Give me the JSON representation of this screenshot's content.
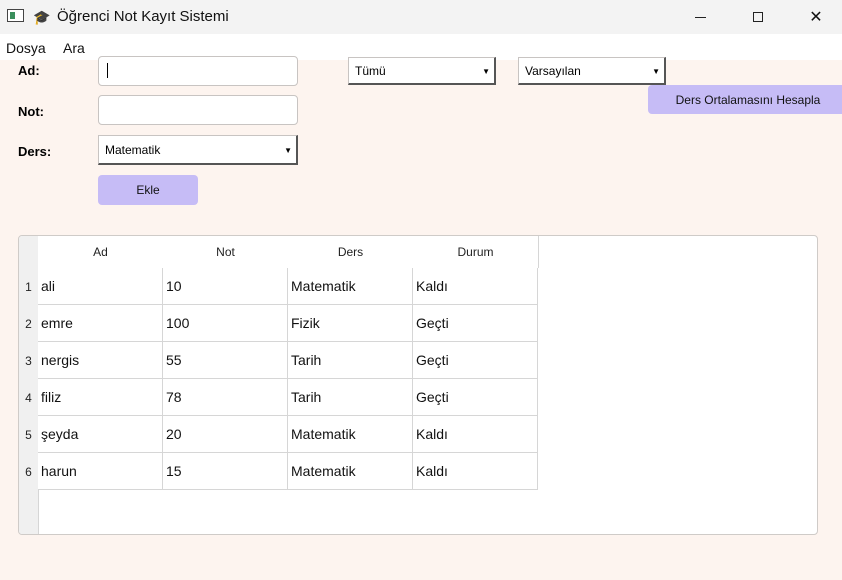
{
  "window": {
    "title": "Öğrenci Not Kayıt Sistemi",
    "controls": {
      "minimize": "—",
      "maximize": "☐",
      "close": "✕"
    }
  },
  "menu": [
    "Dosya",
    "Ara"
  ],
  "form": {
    "ad_label": "Ad:",
    "ad_value": "",
    "not_label": "Not:",
    "not_value": "",
    "ders_label": "Ders:",
    "ders_value": "Matematik",
    "add_button": "Ekle"
  },
  "filters": {
    "course_filter": "Tümü",
    "sort_order": "Varsayılan",
    "average_button": "Ders Ortalamasını Hesapla"
  },
  "table": {
    "headers": [
      "Ad",
      "Not",
      "Ders",
      "Durum"
    ],
    "rows": [
      {
        "num": "1",
        "ad": "ali",
        "not": "10",
        "ders": "Matematik",
        "durum": "Kaldı"
      },
      {
        "num": "2",
        "ad": "emre",
        "not": "100",
        "ders": "Fizik",
        "durum": "Geçti"
      },
      {
        "num": "3",
        "ad": "nergis",
        "not": "55",
        "ders": "Tarih",
        "durum": "Geçti"
      },
      {
        "num": "4",
        "ad": "filiz",
        "not": "78",
        "ders": "Tarih",
        "durum": "Geçti"
      },
      {
        "num": "5",
        "ad": "şeyda",
        "not": "20",
        "ders": "Matematik",
        "durum": "Kaldı"
      },
      {
        "num": "6",
        "ad": "harun",
        "not": "15",
        "ders": "Matematik",
        "durum": "Kaldı"
      }
    ]
  },
  "colors": {
    "background": "#fdf4ef",
    "button": "#c6bcf6"
  }
}
